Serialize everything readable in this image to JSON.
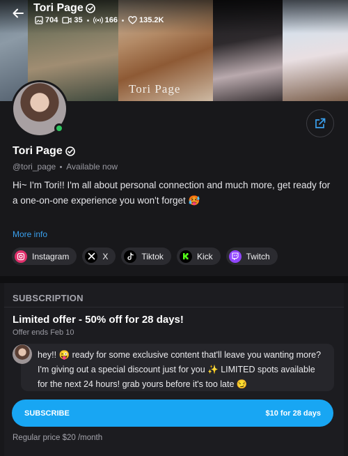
{
  "header": {
    "name": "Tori Page",
    "stats": [
      {
        "icon": "photo-icon",
        "value": "704"
      },
      {
        "icon": "video-icon",
        "value": "35"
      },
      {
        "icon": "live-icon",
        "value": "166"
      },
      {
        "icon": "heart-icon",
        "value": "135.2K"
      }
    ],
    "watermark": "Tori Page"
  },
  "profile": {
    "name": "Tori Page",
    "handle": "@tori_page",
    "status": "Available now",
    "bio": "Hi~ I'm Tori!! I'm all about personal connection and much more, get ready for a one-on-one experience you won't forget 🥵",
    "more_info": "More info"
  },
  "socials": [
    {
      "label": "Instagram",
      "icon": "instagram-icon",
      "color": "#e1306c"
    },
    {
      "label": "X",
      "icon": "x-icon",
      "color": "#000000"
    },
    {
      "label": "Tiktok",
      "icon": "tiktok-icon",
      "color": "#000000"
    },
    {
      "label": "Kick",
      "icon": "kick-icon",
      "color": "#53fc18"
    },
    {
      "label": "Twitch",
      "icon": "twitch-icon",
      "color": "#9146ff"
    }
  ],
  "subscription": {
    "section_title": "SUBSCRIPTION",
    "offer_title": "Limited offer - 50% off for 28 days!",
    "offer_ends": "Offer ends Feb 10",
    "message": "hey!! 😜 ready for some exclusive content that'll leave you wanting more? I'm giving out a special discount just for you ✨ LIMITED spots available for the next 24 hours! grab yours before it's too late 😏",
    "button_label": "SUBSCRIBE",
    "button_price": "$10 for 28 days",
    "regular_price": "Regular price $20 /month"
  },
  "colors": {
    "accent": "#18a6f3",
    "online": "#2ec45f",
    "link": "#3aa0ee"
  }
}
